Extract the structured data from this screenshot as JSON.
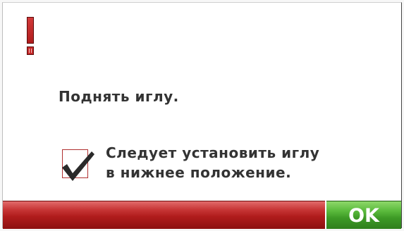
{
  "dialog": {
    "icon": "warning-icon",
    "message": "Поднять иглу.",
    "checkbox": {
      "checked": true,
      "line1": "Следует установить иглу",
      "line2": "в нижнее положение."
    },
    "ok_label": "OK"
  },
  "colors": {
    "alert_red": "#c62828",
    "bar_red": "#b01c1c",
    "ok_green": "#4aa82f"
  }
}
